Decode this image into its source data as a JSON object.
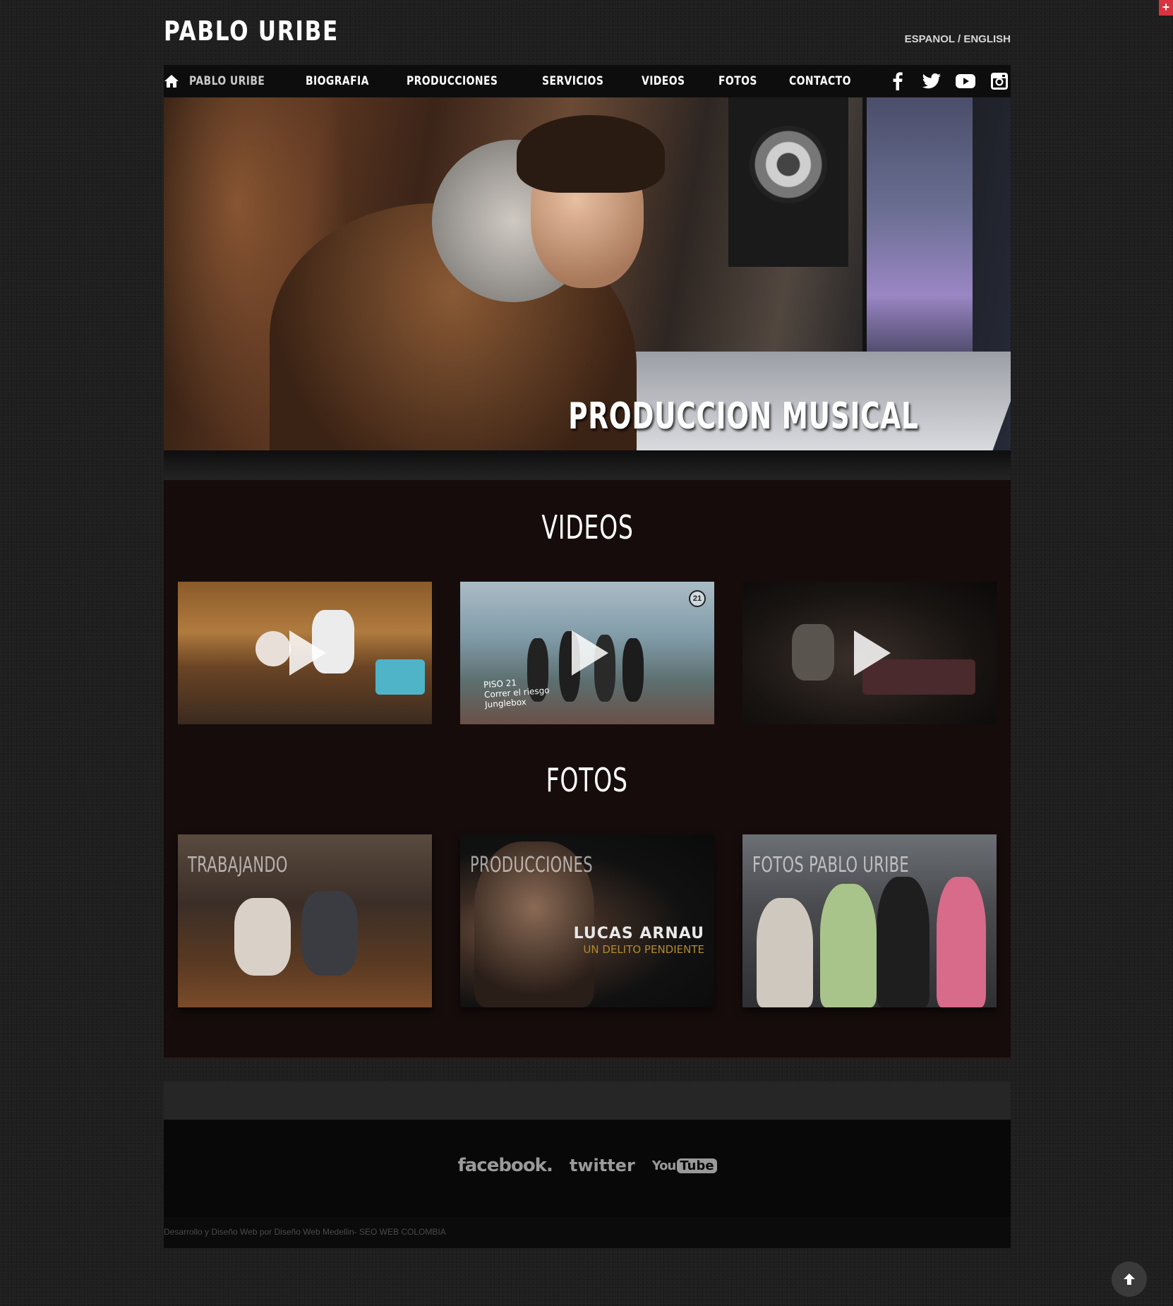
{
  "header": {
    "logo": "PABLO URIBE",
    "lang_es": "ESPANOL",
    "lang_sep": " / ",
    "lang_en": "ENGLISH"
  },
  "nav": {
    "items": [
      "PABLO URIBE",
      "BIOGRAFIA",
      "PRODUCCIONES",
      "SERVICIOS",
      "VIDEOS",
      "FOTOS",
      "CONTACTO"
    ],
    "active_index": 0,
    "icons": [
      "home-icon",
      "facebook-icon",
      "twitter-icon",
      "youtube-icon",
      "instagram-icon"
    ]
  },
  "hero": {
    "title": "PRODUCCION MUSICAL"
  },
  "videos": {
    "title": "VIDEOS",
    "thumb2_overlay": [
      "PISO 21",
      "Correr el riesgo",
      "Junglebox"
    ],
    "thumb2_badge": "21"
  },
  "fotos": {
    "title": "FOTOS",
    "items": [
      "TRABAJANDO",
      "PRODUCCIONES",
      "FOTOS PABLO URIBE"
    ],
    "album_artist": "LUCAS ARNAU",
    "album_title": "UN DELITO PENDIENTE"
  },
  "footer": {
    "facebook": "facebook.",
    "twitter": "twitter",
    "youtube_you": "You",
    "youtube_tube": "Tube",
    "credits": "Desarrollo y Diseño Web por Diseño Web Medellin- SEO WEB COLOMBIA"
  },
  "colors": {
    "accent_corner": "#d9333f",
    "content_bg": "#160c0c",
    "nav_bg": "#0d0d0d"
  }
}
